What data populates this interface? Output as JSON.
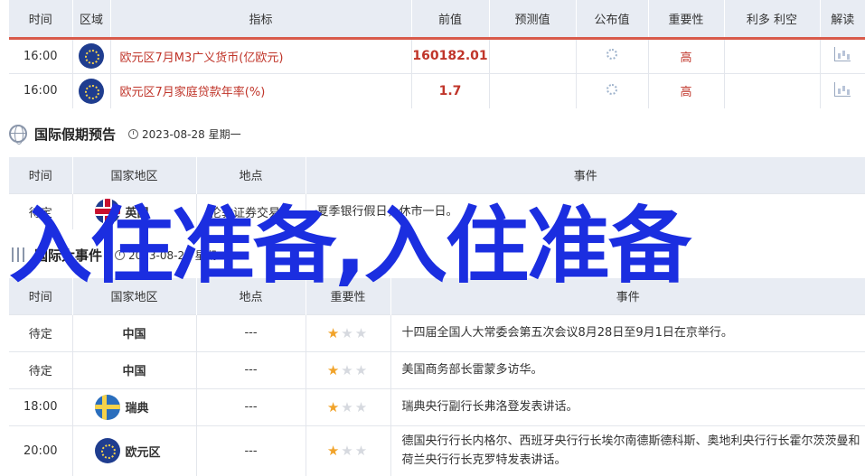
{
  "econ": {
    "headers": [
      "时间",
      "区域",
      "指标",
      "前值",
      "预测值",
      "公布值",
      "重要性",
      "利多 利空",
      "解读"
    ],
    "rows": [
      {
        "time": "16:00",
        "region_icon": "eu-flag-icon",
        "indicator": "欧元区7月M3广义货币(亿欧元)",
        "previous": "160182.01",
        "forecast": "",
        "actual_icon": "loading-icon",
        "importance": "高",
        "bull_bear": "",
        "analysis_icon": "chart-icon"
      },
      {
        "time": "16:00",
        "region_icon": "eu-flag-icon",
        "indicator": "欧元区7月家庭贷款年率(%)",
        "previous": "1.7",
        "forecast": "",
        "actual_icon": "loading-icon",
        "importance": "高",
        "bull_bear": "",
        "analysis_icon": "chart-icon"
      }
    ]
  },
  "holiday_section": {
    "title": "国际假期预告",
    "date": "2023-08-28 星期一",
    "headers": [
      "时间",
      "国家地区",
      "地点",
      "事件"
    ],
    "rows": [
      {
        "time": "待定",
        "flag": "uk-flag-icon",
        "country": "英国",
        "place": "伦敦证券交易所",
        "event": "夏季银行假日，休市一日。"
      }
    ]
  },
  "events_section": {
    "title": "国际大事件",
    "date": "2023-08-28 星期一",
    "headers": [
      "时间",
      "国家地区",
      "地点",
      "重要性",
      "事件"
    ],
    "rows": [
      {
        "time": "待定",
        "flag": "",
        "country": "中国",
        "place": "---",
        "stars": 1,
        "event": "十四届全国人大常委会第五次会议8月28日至9月1日在京举行。"
      },
      {
        "time": "待定",
        "flag": "",
        "country": "中国",
        "place": "---",
        "stars": 1,
        "event": "美国商务部长雷蒙多访华。"
      },
      {
        "time": "18:00",
        "flag": "se-flag-icon",
        "country": "瑞典",
        "place": "---",
        "stars": 1,
        "event": "瑞典央行副行长弗洛登发表讲话。"
      },
      {
        "time": "20:00",
        "flag": "eu-flag-icon",
        "country": "欧元区",
        "place": "---",
        "stars": 1,
        "event": "德国央行行长内格尔、西班牙央行行长埃尔南德斯德科斯、奥地利央行行长霍尔茨茨曼和荷兰央行行长克罗特发表讲话。"
      }
    ]
  },
  "overlay_text": "入住准备,入住准备",
  "colors": {
    "accent_red": "#c0352a",
    "header_bg": "#e8ecf3",
    "overlay_blue": "#1b2ee0",
    "star": "#f1a32a"
  }
}
